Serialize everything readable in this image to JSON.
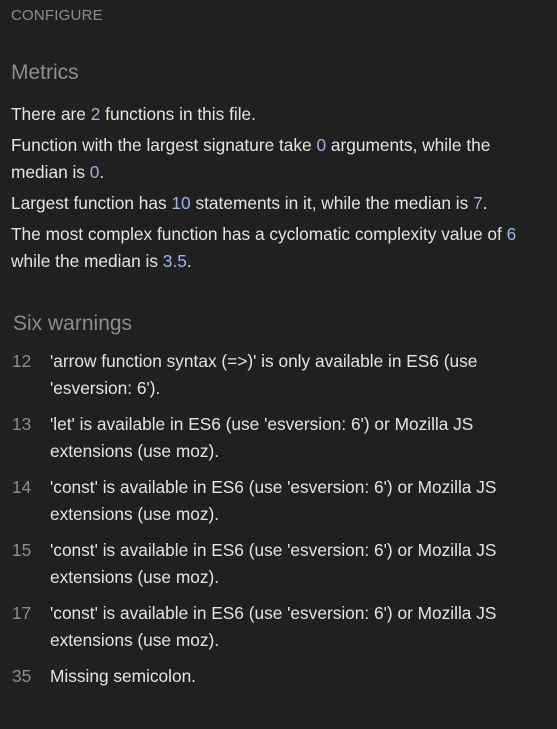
{
  "header": {
    "configure_label": "CONFIGURE"
  },
  "metrics": {
    "title": "Metrics",
    "functions_count": {
      "prefix": "There are ",
      "value": "2",
      "suffix": " functions in this file."
    },
    "signature": {
      "prefix": "Function with the largest signature take ",
      "largest": "0",
      "middle": " arguments, while the median is ",
      "median": "0",
      "suffix": "."
    },
    "statements": {
      "prefix": "Largest function has ",
      "largest": "10",
      "middle": " statements in it, while the median is ",
      "median": "7",
      "suffix": "."
    },
    "complexity": {
      "prefix": "The most complex function has a cyclomatic complexity value of ",
      "largest": "6",
      "middle": " while the median is ",
      "median": "3.5",
      "suffix": "."
    }
  },
  "warnings": {
    "title": "Six warnings",
    "items": [
      {
        "line": "12",
        "text": "'arrow function syntax (=>)' is only available in ES6 (use 'esversion: 6')."
      },
      {
        "line": "13",
        "text": "'let' is available in ES6 (use 'esversion: 6') or Mozilla JS extensions (use moz)."
      },
      {
        "line": "14",
        "text": "'const' is available in ES6 (use 'esversion: 6') or Mozilla JS extensions (use moz)."
      },
      {
        "line": "15",
        "text": "'const' is available in ES6 (use 'esversion: 6') or Mozilla JS extensions (use moz)."
      },
      {
        "line": "17",
        "text": "'const' is available in ES6 (use 'esversion: 6') or Mozilla JS extensions (use moz)."
      },
      {
        "line": "35",
        "text": "Missing semicolon."
      }
    ]
  }
}
